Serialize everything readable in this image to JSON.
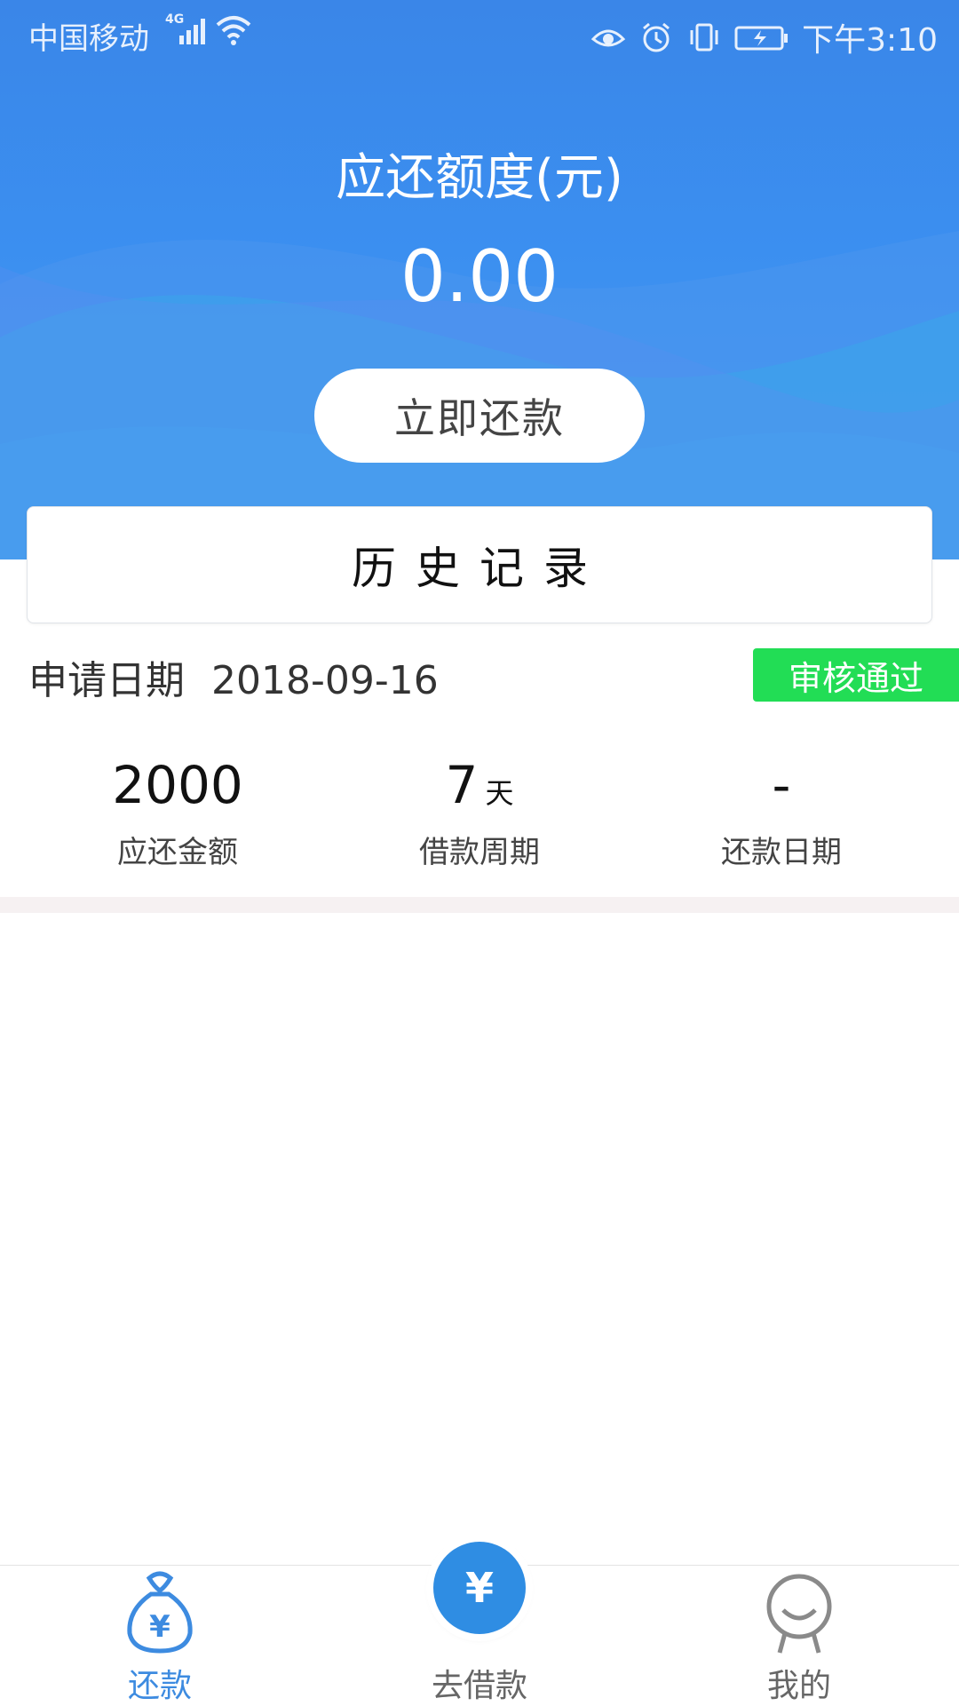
{
  "status_bar": {
    "carrier": "中国移动",
    "network": "4G",
    "time": "下午3:10"
  },
  "header": {
    "title": "应还额度(元)",
    "amount": "0.00",
    "pay_button": "立即还款"
  },
  "history_button": "历史记录",
  "record": {
    "date_label": "申请日期",
    "date": "2018-09-16",
    "status": "审核通过",
    "stats": [
      {
        "value": "2000",
        "unit": "",
        "label": "应还金额"
      },
      {
        "value": "7",
        "unit": "天",
        "label": "借款周期"
      },
      {
        "value": "-",
        "unit": "",
        "label": "还款日期"
      }
    ]
  },
  "tabbar": {
    "tabs": [
      {
        "label": "还款",
        "icon": "money-bag-icon",
        "active": true
      },
      {
        "label": "去借款",
        "icon": "yuan-coin-icon",
        "active": false
      },
      {
        "label": "我的",
        "icon": "profile-icon",
        "active": false
      }
    ]
  },
  "colors": {
    "header_blue": "#3a86e8",
    "accent_blue": "#3d8be0",
    "status_green": "#22dd55"
  }
}
